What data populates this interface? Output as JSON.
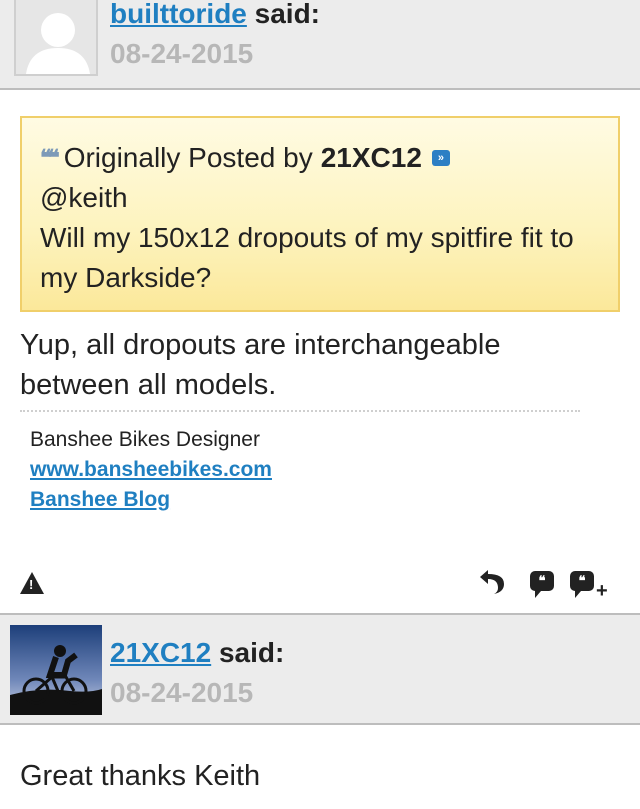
{
  "posts": [
    {
      "author": "builttoride",
      "said": "said:",
      "date": "08-24-2015",
      "quote": {
        "prefix": "Originally Posted by",
        "author": "21XC12",
        "line1": "@keith",
        "line2": "Will my 150x12 dropouts of my spitfire fit to my Darkside?"
      },
      "body": "Yup, all dropouts are interchangeable between all models.",
      "signature": {
        "title": "Banshee Bikes Designer",
        "link1": "www.bansheebikes.com",
        "link2": "Banshee Blog"
      },
      "actions": [
        "report-icon",
        "reply-icon",
        "quote-icon",
        "multi-quote-icon"
      ]
    },
    {
      "author": "21XC12",
      "said": "said:",
      "date": "08-24-2015",
      "body": "Great thanks Keith"
    }
  ],
  "colors": {
    "link": "#1f7fc1",
    "date": "#b7b7b7",
    "header_bg": "#ececec",
    "quote_border": "#f0cf6a",
    "quote_bg": "#fdf3bd"
  }
}
